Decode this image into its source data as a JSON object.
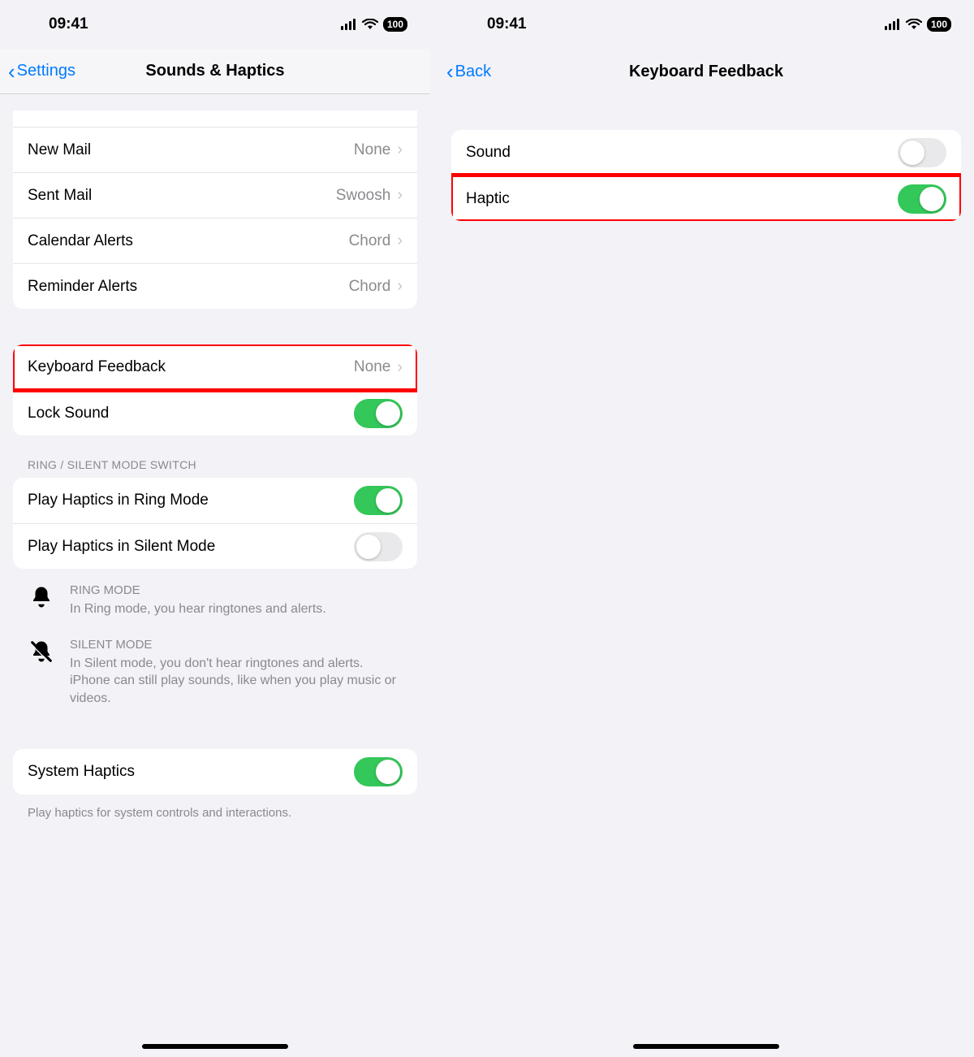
{
  "status": {
    "time": "09:41",
    "battery": "100"
  },
  "left": {
    "back": "Settings",
    "title": "Sounds & Haptics",
    "rows1": [
      {
        "label": "New Mail",
        "value": "None"
      },
      {
        "label": "Sent Mail",
        "value": "Swoosh"
      },
      {
        "label": "Calendar Alerts",
        "value": "Chord"
      },
      {
        "label": "Reminder Alerts",
        "value": "Chord"
      }
    ],
    "keyboard": {
      "label": "Keyboard Feedback",
      "value": "None"
    },
    "lock": {
      "label": "Lock Sound"
    },
    "section_header": "RING / SILENT MODE SWITCH",
    "ring_row": {
      "label": "Play Haptics in Ring Mode"
    },
    "silent_row": {
      "label": "Play Haptics in Silent Mode"
    },
    "ring_info": {
      "title": "RING MODE",
      "desc": "In Ring mode, you hear ringtones and alerts."
    },
    "silent_info": {
      "title": "SILENT MODE",
      "desc": "In Silent mode, you don't hear ringtones and alerts. iPhone can still play sounds, like when you play music or videos."
    },
    "system": {
      "label": "System Haptics"
    },
    "footer": "Play haptics for system controls and interactions."
  },
  "right": {
    "back": "Back",
    "title": "Keyboard Feedback",
    "sound": {
      "label": "Sound"
    },
    "haptic": {
      "label": "Haptic"
    }
  }
}
